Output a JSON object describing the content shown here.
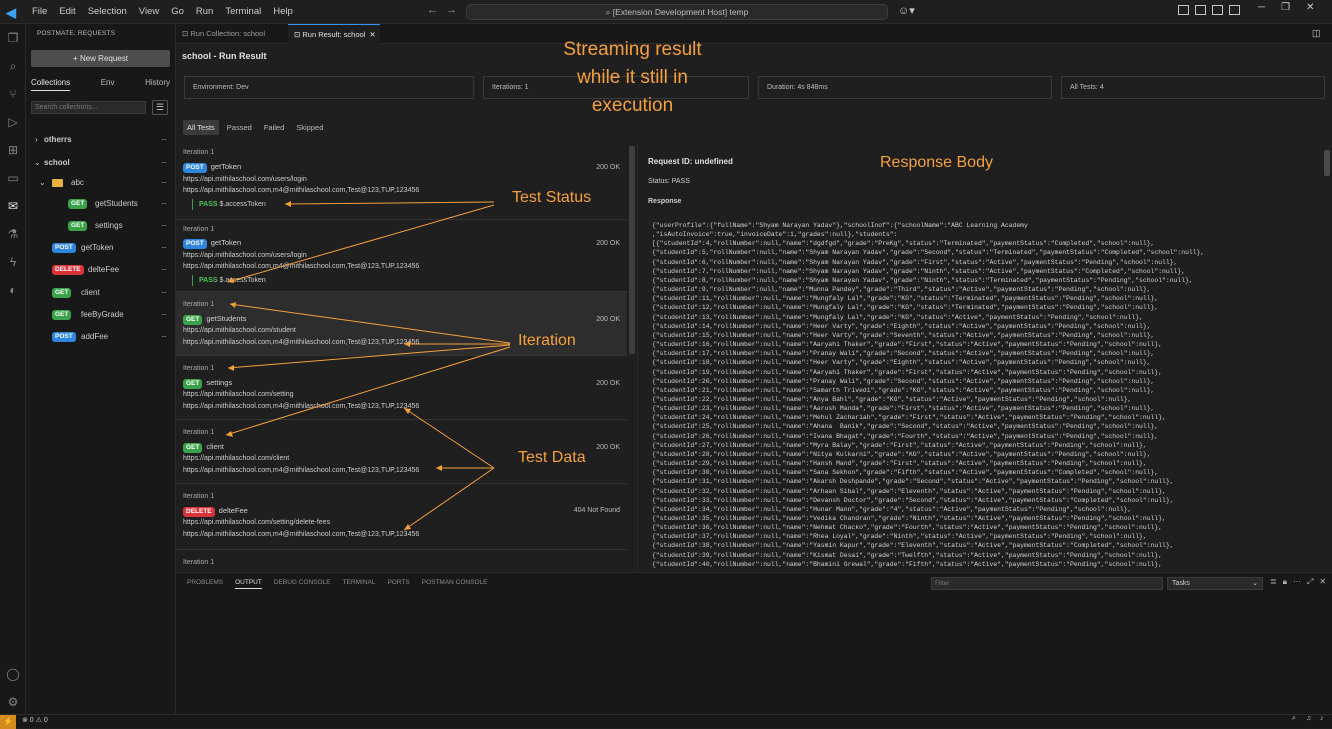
{
  "menu": [
    "File",
    "Edit",
    "Selection",
    "View",
    "Go",
    "Run",
    "Terminal",
    "Help"
  ],
  "command_center": "[Extension Development Host] temp",
  "sidebar": {
    "title": "POSTMATE: REQUESTS",
    "new_request": "New Request",
    "tabs": [
      "Collections",
      "Env",
      "History"
    ],
    "search_placeholder": "Search collections...",
    "tree": [
      {
        "label": "otherrs",
        "type": "folder"
      },
      {
        "label": "school",
        "type": "folder"
      },
      {
        "label": "abc",
        "type": "subfolder"
      },
      {
        "method": "GET",
        "label": "getStudents"
      },
      {
        "method": "GET",
        "label": "settings"
      },
      {
        "method": "POST",
        "label": "getToken"
      },
      {
        "method": "DELETE",
        "label": "delteFee"
      },
      {
        "method": "GET",
        "label": "client"
      },
      {
        "method": "GET",
        "label": "feeByGrade"
      },
      {
        "method": "POST",
        "label": "addFee"
      }
    ]
  },
  "editor_tabs": [
    "Run Collection: school",
    "Run Result: school"
  ],
  "run": {
    "title": "school - Run Result",
    "environment": "Environment: Dev",
    "iterations": "Iterations: 1",
    "duration": "Duration: 4s 848ms",
    "all_tests": "All Tests: 4",
    "filters": [
      "All Tests",
      "Passed",
      "Failed",
      "Skipped"
    ]
  },
  "results": [
    {
      "iteration": "Iteration 1",
      "method": "POST",
      "name": "getToken",
      "url": "https://api.mithilaschool.com/users/login",
      "data": "https://api.mithilaschool.com,m4@mithilaschool.com,Test@123,TUP,123456",
      "status": "200 OK",
      "test": "PASS",
      "test_name": "$.accessToken"
    },
    {
      "iteration": "Iteration 1",
      "method": "POST",
      "name": "getToken",
      "url": "https://api.mithilaschool.com/users/login",
      "data": "https://api.mithilaschool.com,m4@mithilaschool.com,Test@123,TUP,123456",
      "status": "200 OK",
      "test": "PASS",
      "test_name": "$.accessToken"
    },
    {
      "iteration": "Iteration 1",
      "method": "GET",
      "name": "getStudents",
      "url": "https://api.mithilaschool.com/student",
      "data": "https://api.mithilaschool.com,m4@mithilaschool.com,Test@123,TUP,123456",
      "status": "200 OK"
    },
    {
      "iteration": "Iteration 1",
      "method": "GET",
      "name": "settings",
      "url": "https://api.mithilaschool.com/setting",
      "data": "https://api.mithilaschool.com,m4@mithilaschool.com,Test@123,TUP,123456",
      "status": "200 OK"
    },
    {
      "iteration": "Iteration 1",
      "method": "GET",
      "name": "client",
      "url": "https://api.mithilaschool.com/client",
      "data": "https://api.mithilaschool.com,m4@mithilaschool.com,Test@123,TUP,123456",
      "status": "200 OK"
    },
    {
      "iteration": "Iteration 1",
      "method": "DELETE",
      "name": "delteFee",
      "url": "https://api.mithilaschool.com/setting/delete-fees",
      "data": "https://api.mithilaschool.com,m4@mithilaschool.com,Test@123,TUP,123456",
      "status": "404 Not Found"
    },
    {
      "iteration": "Iteration 1"
    }
  ],
  "response": {
    "request_id": "Request ID: undefined",
    "status": "Status: PASS",
    "label": "Response",
    "body": [
      "{\"userProfile\":{\"fullName\":\"Shyam Narayan Yadav\"},\"schoolInof\":{\"schoolName\":\"ABC Learning Academy",
      ",\"isAutoInvoice\":true,\"invoiceDate\":1,\"grades\":null},\"students\":",
      "[{\"studentId\":4,\"rollNumber\":null,\"name\":\"dgdfgd\",\"grade\":\"PreKg\",\"status\":\"Terminated\",\"paymentStatus\":\"Completed\",\"school\":null},",
      "{\"studentId\":5,\"rollNumber\":null,\"name\":\"Shyam Narayan Yadav\",\"grade\":\"Second\",\"status\":\"Terminated\",\"paymentStatus\":\"Completed\",\"school\":null},",
      "{\"studentId\":6,\"rollNumber\":null,\"name\":\"Shyam Narayan Yadav\",\"grade\":\"First\",\"status\":\"Active\",\"paymentStatus\":\"Pending\",\"school\":null},",
      "{\"studentId\":7,\"rollNumber\":null,\"name\":\"Shyam Narayan Yadav\",\"grade\":\"Ninth\",\"status\":\"Active\",\"paymentStatus\":\"Completed\",\"school\":null},",
      "{\"studentId\":8,\"rollNumber\":null,\"name\":\"Shyam Narayan Yadav\",\"grade\":\"Ninth\",\"status\":\"Terminated\",\"paymentStatus\":\"Pending\",\"school\":null},",
      "{\"studentId\":9,\"rollNumber\":null,\"name\":\"Munna Pandey\",\"grade\":\"Third\",\"status\":\"Active\",\"paymentStatus\":\"Pending\",\"school\":null},",
      "{\"studentId\":11,\"rollNumber\":null,\"name\":\"Mungfaly Lal\",\"grade\":\"KG\",\"status\":\"Terminated\",\"paymentStatus\":\"Pending\",\"school\":null},",
      "{\"studentId\":12,\"rollNumber\":null,\"name\":\"Mungfaly Lal\",\"grade\":\"KG\",\"status\":\"Terminated\",\"paymentStatus\":\"Pending\",\"school\":null},",
      "{\"studentId\":13,\"rollNumber\":null,\"name\":\"Mungfaly Lal\",\"grade\":\"KG\",\"status\":\"Active\",\"paymentStatus\":\"Pending\",\"school\":null},",
      "{\"studentId\":14,\"rollNumber\":null,\"name\":\"Heer Varty\",\"grade\":\"Eighth\",\"status\":\"Active\",\"paymentStatus\":\"Pending\",\"school\":null},",
      "{\"studentId\":15,\"rollNumber\":null,\"name\":\"Heer Varty\",\"grade\":\"Seventh\",\"status\":\"Active\",\"paymentStatus\":\"Pending\",\"school\":null},",
      "{\"studentId\":16,\"rollNumber\":null,\"name\":\"Aaryahi Thaker\",\"grade\":\"First\",\"status\":\"Active\",\"paymentStatus\":\"Pending\",\"school\":null},",
      "{\"studentId\":17,\"rollNumber\":null,\"name\":\"Pranay Wali\",\"grade\":\"Second\",\"status\":\"Active\",\"paymentStatus\":\"Pending\",\"school\":null},",
      "{\"studentId\":18,\"rollNumber\":null,\"name\":\"Heer Varty\",\"grade\":\"Eighth\",\"status\":\"Active\",\"paymentStatus\":\"Pending\",\"school\":null},",
      "{\"studentId\":19,\"rollNumber\":null,\"name\":\"Aaryahi Thaker\",\"grade\":\"First\",\"status\":\"Active\",\"paymentStatus\":\"Pending\",\"school\":null},",
      "{\"studentId\":20,\"rollNumber\":null,\"name\":\"Pranay Wali\",\"grade\":\"Second\",\"status\":\"Active\",\"paymentStatus\":\"Pending\",\"school\":null},",
      "{\"studentId\":21,\"rollNumber\":null,\"name\":\"Samarth Trivedi\",\"grade\":\"KG\",\"status\":\"Active\",\"paymentStatus\":\"Pending\",\"school\":null},",
      "{\"studentId\":22,\"rollNumber\":null,\"name\":\"Anya Bahl\",\"grade\":\"KG\",\"status\":\"Active\",\"paymentStatus\":\"Pending\",\"school\":null},",
      "{\"studentId\":23,\"rollNumber\":null,\"name\":\"Aarush Manda\",\"grade\":\"First\",\"status\":\"Active\",\"paymentStatus\":\"Pending\",\"school\":null},",
      "{\"studentId\":24,\"rollNumber\":null,\"name\":\"Mehul Zachariah\",\"grade\":\"First\",\"status\":\"Active\",\"paymentStatus\":\"Pending\",\"school\":null},",
      "{\"studentId\":25,\"rollNumber\":null,\"name\":\"Ahana  Banik\",\"grade\":\"Second\",\"status\":\"Active\",\"paymentStatus\":\"Pending\",\"school\":null},",
      "{\"studentId\":26,\"rollNumber\":null,\"name\":\"Ivana Bhagat\",\"grade\":\"Fourth\",\"status\":\"Active\",\"paymentStatus\":\"Pending\",\"school\":null},",
      "{\"studentId\":27,\"rollNumber\":null,\"name\":\"Myra Balay\",\"grade\":\"First\",\"status\":\"Active\",\"paymentStatus\":\"Pending\",\"school\":null},",
      "{\"studentId\":28,\"rollNumber\":null,\"name\":\"Nitya Kulkarni\",\"grade\":\"KG\",\"status\":\"Active\",\"paymentStatus\":\"Pending\",\"school\":null},",
      "{\"studentId\":29,\"rollNumber\":null,\"name\":\"Hansh Mand\",\"grade\":\"First\",\"status\":\"Active\",\"paymentStatus\":\"Pending\",\"school\":null},",
      "{\"studentId\":30,\"rollNumber\":null,\"name\":\"Sana Sekhon\",\"grade\":\"Fifth\",\"status\":\"Active\",\"paymentStatus\":\"Completed\",\"school\":null},",
      "{\"studentId\":31,\"rollNumber\":null,\"name\":\"Akarsh Deshpande\",\"grade\":\"Second\",\"status\":\"Active\",\"paymentStatus\":\"Pending\",\"school\":null},",
      "{\"studentId\":32,\"rollNumber\":null,\"name\":\"Arhaan Sibal\",\"grade\":\"Eleventh\",\"status\":\"Active\",\"paymentStatus\":\"Pending\",\"school\":null},",
      "{\"studentId\":33,\"rollNumber\":null,\"name\":\"Devansh Doctor\",\"grade\":\"Second\",\"status\":\"Active\",\"paymentStatus\":\"Completed\",\"school\":null},",
      "{\"studentId\":34,\"rollNumber\":null,\"name\":\"Hunar Mann\",\"grade\":\"4\",\"status\":\"Active\",\"paymentStatus\":\"Pending\",\"school\":null},",
      "{\"studentId\":35,\"rollNumber\":null,\"name\":\"Vedika Chandran\",\"grade\":\"Ninth\",\"status\":\"Active\",\"paymentStatus\":\"Pending\",\"school\":null},",
      "{\"studentId\":36,\"rollNumber\":null,\"name\":\"Nehmat Chacko\",\"grade\":\"Fourth\",\"status\":\"Active\",\"paymentStatus\":\"Pending\",\"school\":null},",
      "{\"studentId\":37,\"rollNumber\":null,\"name\":\"Rhea Loyal\",\"grade\":\"Ninth\",\"status\":\"Active\",\"paymentStatus\":\"Pending\",\"school\":null},",
      "{\"studentId\":38,\"rollNumber\":null,\"name\":\"Yasmin Kapur\",\"grade\":\"Eleventh\",\"status\":\"Active\",\"paymentStatus\":\"Completed\",\"school\":null},",
      "{\"studentId\":39,\"rollNumber\":null,\"name\":\"Kismat Desai\",\"grade\":\"Twelfth\",\"status\":\"Active\",\"paymentStatus\":\"Pending\",\"school\":null},",
      "{\"studentId\":40,\"rollNumber\":null,\"name\":\"Bhamini Grewal\",\"grade\":\"Fifth\",\"status\":\"Active\",\"paymentStatus\":\"Pending\",\"school\":null},"
    ]
  },
  "panel": {
    "tabs": [
      "PROBLEMS",
      "OUTPUT",
      "DEBUG CONSOLE",
      "TERMINAL",
      "PORTS",
      "POSTMAN CONSOLE"
    ],
    "active_tab": "OUTPUT",
    "filter_placeholder": "Filter",
    "task_select": "Tasks"
  },
  "statusbar": {
    "problems": "⊗ 0 ⚠ 0"
  },
  "annotations": {
    "streaming": [
      "Streaming result",
      "while it still in",
      "execution"
    ],
    "response_body": "Response Body",
    "test_status": "Test Status",
    "iteration": "Iteration",
    "test_data": "Test Data"
  },
  "colors": {
    "annotation": "#f5a03b",
    "get": "#3aa34a",
    "post": "#2e86de",
    "delete": "#d9343a",
    "pass": "#4ec35a"
  }
}
